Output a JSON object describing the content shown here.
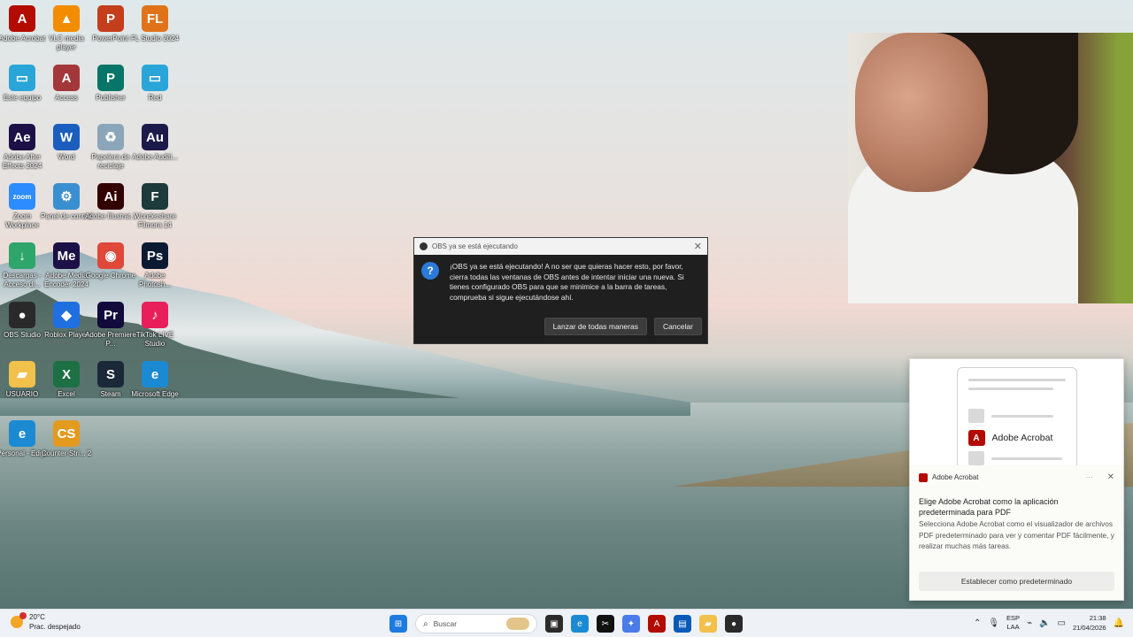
{
  "desktop": {
    "icons": [
      {
        "label": "Adobe Acrobat",
        "color": "#b30b00",
        "glyph": "A"
      },
      {
        "label": "VLC media player",
        "color": "#f28c00",
        "glyph": "▲"
      },
      {
        "label": "PowerPoint",
        "color": "#c43e1c",
        "glyph": "P"
      },
      {
        "label": "FL Studio 2024",
        "color": "#e0731a",
        "glyph": "FL"
      },
      {
        "label": "Este equipo",
        "color": "#2aa5d8",
        "glyph": "▭"
      },
      {
        "label": "Access",
        "color": "#a4373a",
        "glyph": "A"
      },
      {
        "label": "Publisher",
        "color": "#077568",
        "glyph": "P"
      },
      {
        "label": "Red",
        "color": "#2aa5d8",
        "glyph": "▭"
      },
      {
        "label": "Adobe After Effects 2024",
        "color": "#1d1046",
        "glyph": "Ae"
      },
      {
        "label": "Word",
        "color": "#1b5ebe",
        "glyph": "W"
      },
      {
        "label": "Papelera de reciclaje",
        "color": "#8aa6b8",
        "glyph": "♻"
      },
      {
        "label": "Adobe Auditi...",
        "color": "#1c1a4a",
        "glyph": "Au"
      },
      {
        "label": "Zoom Workplace",
        "color": "#2d8cff",
        "glyph": "zoom"
      },
      {
        "label": "Panel de control",
        "color": "#3a8fd0",
        "glyph": "⚙"
      },
      {
        "label": "Adobe Illustrat...",
        "color": "#330000",
        "glyph": "Ai"
      },
      {
        "label": "Wondershare Filmora 14",
        "color": "#1c3b3a",
        "glyph": "F"
      },
      {
        "label": "Descargas - Acceso di...",
        "color": "#2ea56b",
        "glyph": "↓"
      },
      {
        "label": "Adobe Media Encoder 2024",
        "color": "#1c1046",
        "glyph": "Me"
      },
      {
        "label": "Google Chrome",
        "color": "#e0483a",
        "glyph": "◉"
      },
      {
        "label": "Adobe Photosh...",
        "color": "#0b1a33",
        "glyph": "Ps"
      },
      {
        "label": "OBS Studio",
        "color": "#2a2a2a",
        "glyph": "●"
      },
      {
        "label": "Roblox Player",
        "color": "#1f6fe0",
        "glyph": "◆"
      },
      {
        "label": "Adobe Premiere P...",
        "color": "#110a3a",
        "glyph": "Pr"
      },
      {
        "label": "TikTok LIVE Studio",
        "color": "#e81f5a",
        "glyph": "♪"
      },
      {
        "label": "USUARIO",
        "color": "#f2c14b",
        "glyph": "▰"
      },
      {
        "label": "Excel",
        "color": "#1d7044",
        "glyph": "X"
      },
      {
        "label": "Steam",
        "color": "#1b2838",
        "glyph": "S"
      },
      {
        "label": "Microsoft Edge",
        "color": "#1b8ad3",
        "glyph": "e"
      },
      {
        "label": "Personal - Edge",
        "color": "#1b8ad3",
        "glyph": "e"
      },
      {
        "label": "Counter-Stri... 2",
        "color": "#e29a1f",
        "glyph": "CS"
      }
    ]
  },
  "dialog": {
    "title": "OBS ya se está ejecutando",
    "message": "¡OBS ya se está ejecutando! A no ser que quieras hacer esto, por favor, cierra todas las ventanas de OBS antes de intentar iniciar una nueva. Si tienes configurado OBS para que se minimice a la barra de tareas, comprueba si sigue ejecutándose ahí.",
    "launch_label": "Lanzar de todas maneras",
    "cancel_label": "Cancelar"
  },
  "toast": {
    "hero_label": "Adobe Acrobat",
    "app_name": "Adobe Acrobat",
    "dots": "···",
    "title": "Elige Adobe Acrobat como la aplicación predeterminada para PDF",
    "description": "Selecciona Adobe Acrobat como el visualizador de archivos PDF predeterminado para ver y comentar PDF fácilmente, y realizar muchas más tareas.",
    "action_label": "Establecer como predeterminado"
  },
  "taskbar": {
    "temperature": "20°C",
    "weather": "Prac. despejado",
    "search_placeholder": "Buscar",
    "lang_top": "ESP",
    "lang_bottom": "LAA",
    "time": "21:38",
    "date": "21/04/2026"
  }
}
